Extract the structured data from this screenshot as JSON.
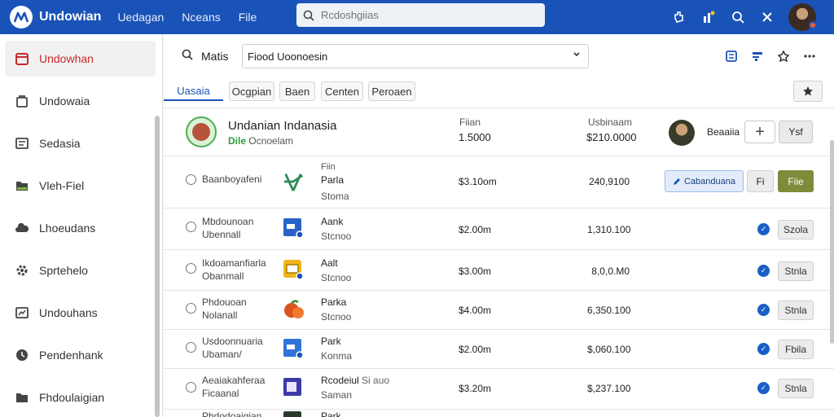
{
  "app": {
    "title": "Undowian",
    "nav": [
      "Uedagan",
      "Nceans",
      "File"
    ]
  },
  "top_search": {
    "placeholder": "Rcdoshgiias"
  },
  "sidebar": {
    "items": [
      {
        "label": "Undowhan",
        "icon": "calendar-icon",
        "active": true
      },
      {
        "label": "Undowaia",
        "icon": "bag-icon"
      },
      {
        "label": "Sedasia",
        "icon": "document-icon"
      },
      {
        "label": "Vleh-Fiel",
        "icon": "folder-icon"
      },
      {
        "label": "Lhoeudans",
        "icon": "cloud-icon"
      },
      {
        "label": "Sprtehelo",
        "icon": "gear-icon"
      },
      {
        "label": "Undouhans",
        "icon": "chart-icon"
      },
      {
        "label": "Pendenhank",
        "icon": "clock-icon"
      },
      {
        "label": "Fhdoulaigian",
        "icon": "file-icon"
      }
    ]
  },
  "toolbar": {
    "label": "Matis",
    "select_value": "Fiood Uoonoesin"
  },
  "tabs": [
    "Uasaia",
    "Ocgpian",
    "Baen",
    "Centen",
    "Peroaen"
  ],
  "header_row": {
    "title": "Undanian Indanasia",
    "sub_prefix": "Dile",
    "sub_text": "Ocnoelam",
    "col1_label": "Fiian",
    "col1_value": "1.5000",
    "col2_label": "Usbinaam",
    "col2_value": "$210.0000",
    "owner": "Beaaiia",
    "action_label": "Ysf"
  },
  "rows": [
    {
      "name1": "Baanboyafeni",
      "name2": "",
      "icon": "palm-logo-icon",
      "t0": "Fiin",
      "t1": "Parla",
      "t2": "Stoma",
      "price": "$3.10om",
      "amount": "240,9100",
      "action1": "Cabanduana",
      "action2": "Fi",
      "action3": "Fiie"
    },
    {
      "name1": "Mbdounoan",
      "name2": "Ubennall",
      "icon": "blue-app-icon",
      "t1": "Aank",
      "t2": "Stcnoo",
      "price": "$2.00m",
      "amount": "1,310.100",
      "action": "Szola"
    },
    {
      "name1": "Ikdoamanfiarla",
      "name2": "Obanmall",
      "icon": "yellow-app-icon",
      "t1": "Aalt",
      "t2": "Stcnoo",
      "price": "$3.00m",
      "amount": "8,0,0.M0",
      "action": "Stnla"
    },
    {
      "name1": "Phdouoan",
      "name2": "Nolanall",
      "icon": "fruit-icon",
      "t1": "Parka",
      "t2": "Stcnoo",
      "price": "$4.00m",
      "amount": "6,350.100",
      "action": "Stnla"
    },
    {
      "name1": "Usdoonnuaria",
      "name2": "Ubaman/",
      "icon": "blue-app-icon",
      "t1": "Park",
      "t2": "Konma",
      "price": "$2.00m",
      "amount": "$,060.100",
      "action": "Fbila"
    },
    {
      "name1": "Aeaiakahferaa",
      "name2": "Ficaanal",
      "icon": "purple-app-icon",
      "t1": "Rcodeiul",
      "t1b": "Si auo",
      "t2": "Saman",
      "price": "$3.20m",
      "amount": "$,237.100",
      "action": "Stnla"
    },
    {
      "name1": "Phdodoaigian",
      "icon": "dark-app-icon",
      "t1": "Park"
    }
  ]
}
